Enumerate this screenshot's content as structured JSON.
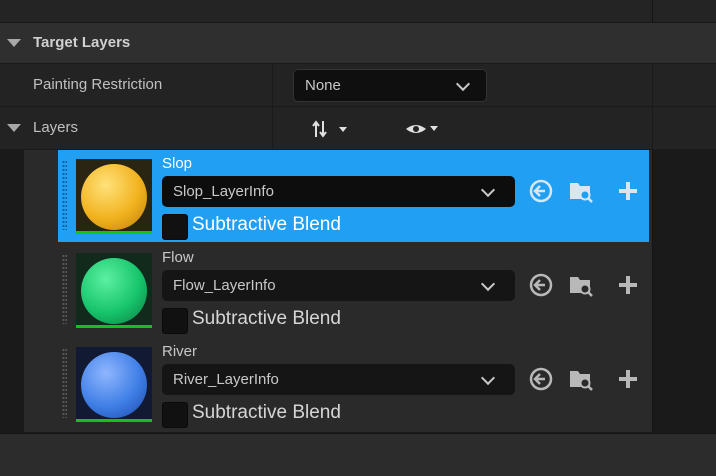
{
  "section": {
    "title": "Target Layers"
  },
  "painting_restriction": {
    "label": "Painting Restriction",
    "value": "None"
  },
  "layers_header": {
    "label": "Layers",
    "sort_icon": "sort-arrows-icon",
    "visibility_icon": "eye-icon"
  },
  "layers": [
    {
      "name": "Slop",
      "layer_info": "Slop_LayerInfo",
      "checkbox_label": "Subtractive Blend",
      "selected": true,
      "color": "#f2b21f"
    },
    {
      "name": "Flow",
      "layer_info": "Flow_LayerInfo",
      "checkbox_label": "Subtractive Blend",
      "selected": false,
      "color": "#17c56c"
    },
    {
      "name": "River",
      "layer_info": "River_LayerInfo",
      "checkbox_label": "Subtractive Blend",
      "selected": false,
      "color": "#3f7fe6"
    }
  ],
  "colors": {
    "selection": "#219ff3",
    "thumbnail_bar": "#12c418"
  }
}
